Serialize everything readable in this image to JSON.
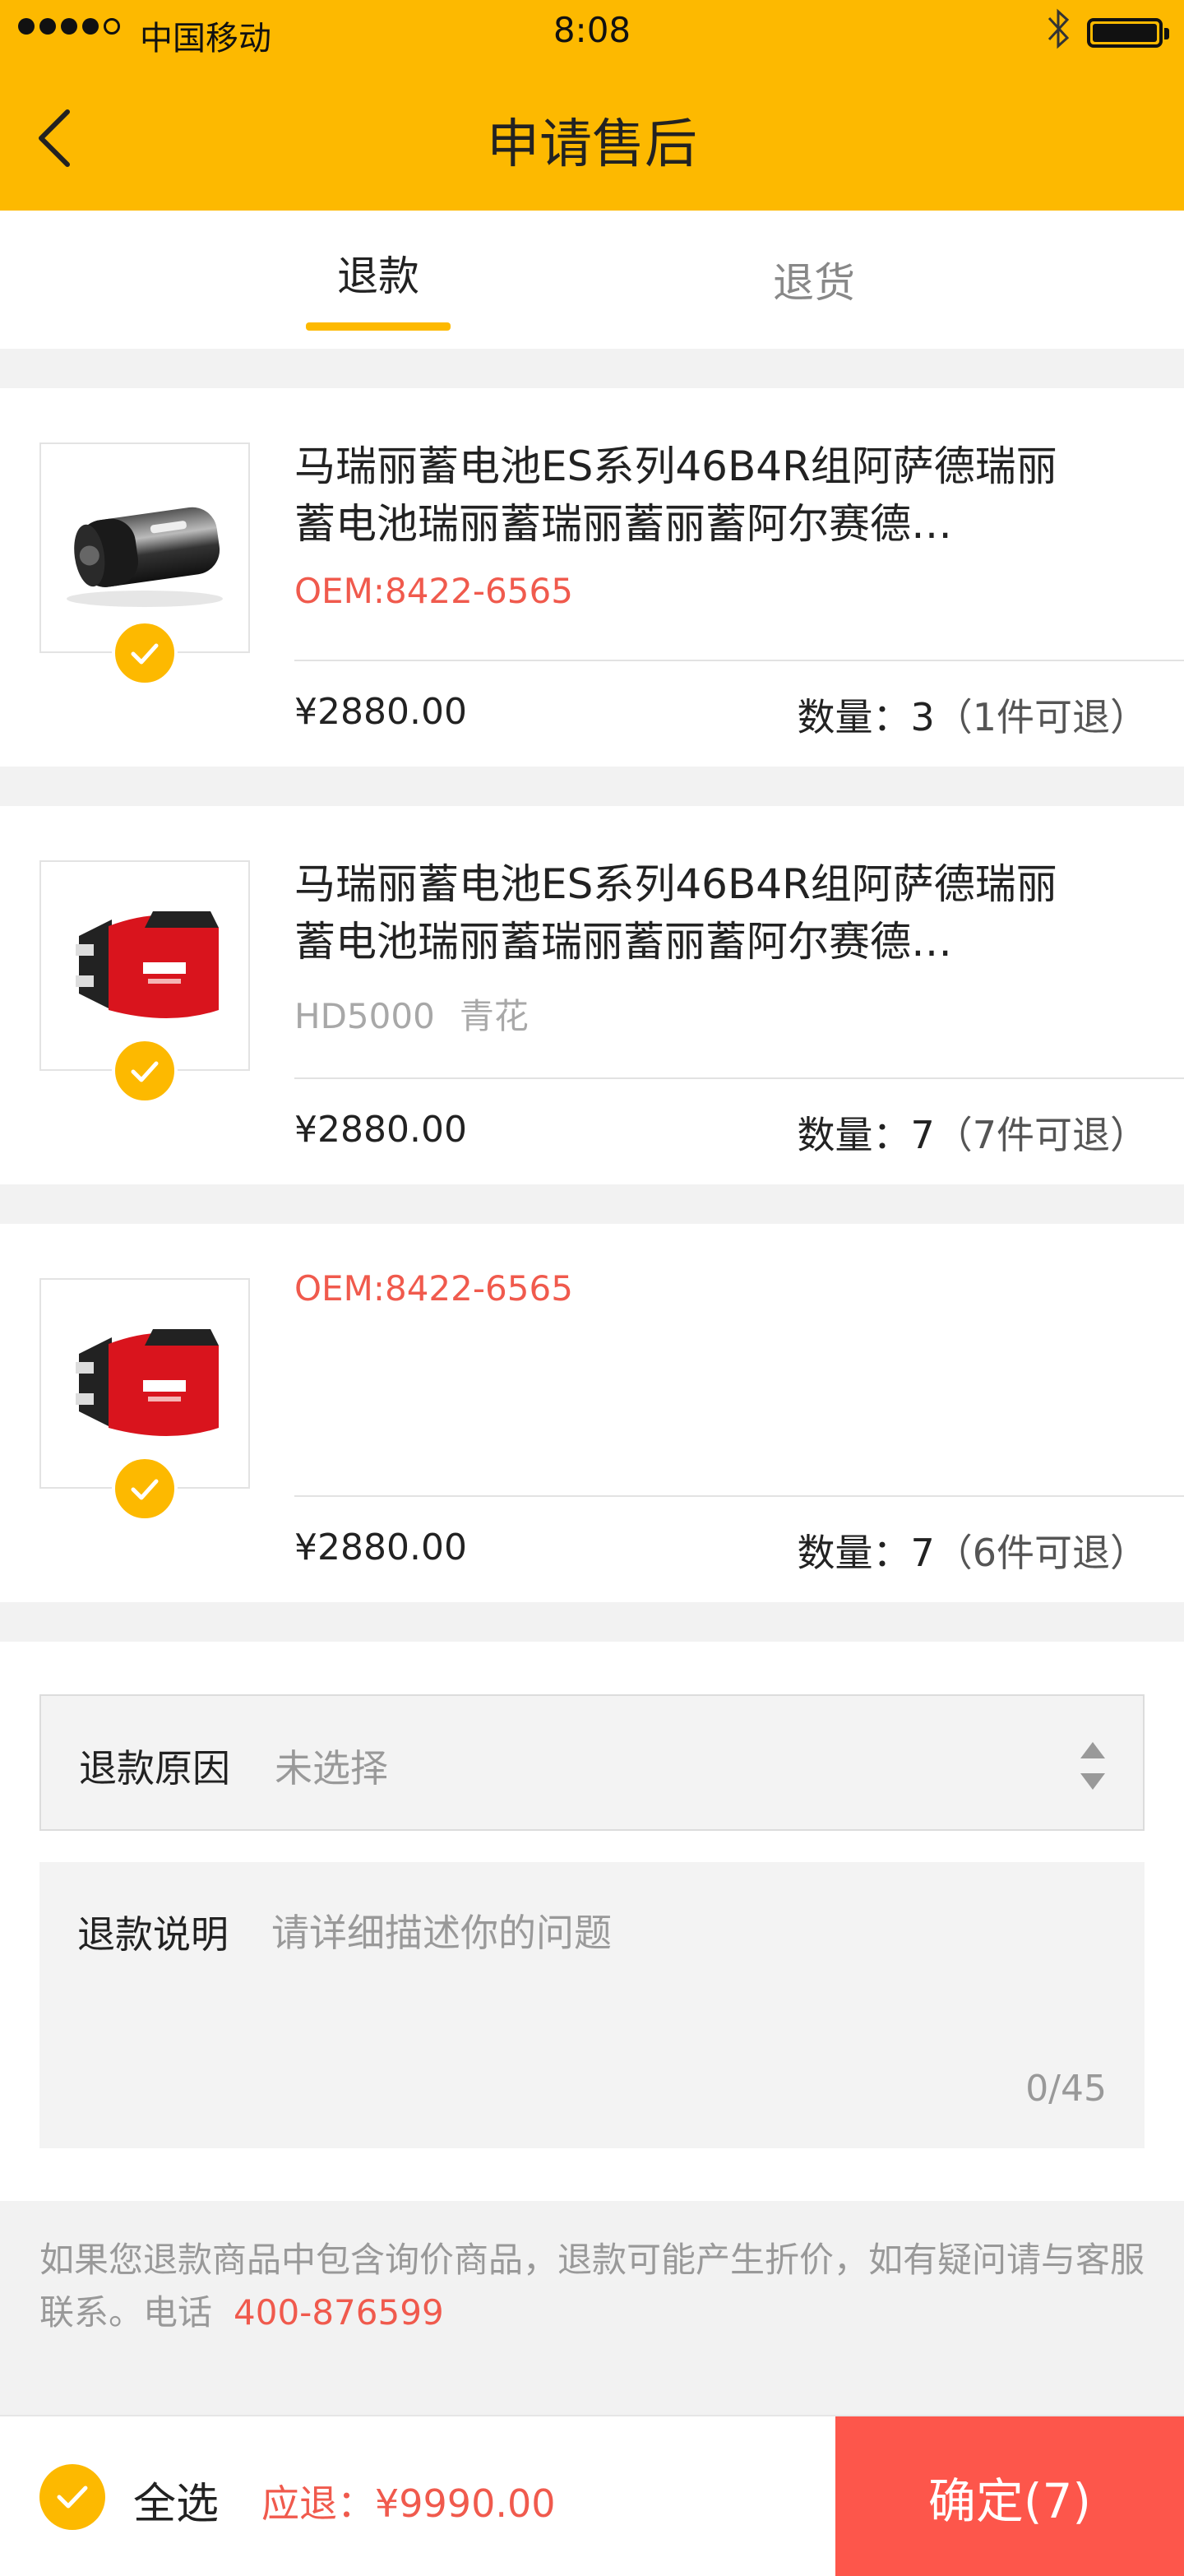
{
  "status_bar": {
    "carrier": "中国移动",
    "time": "8:08"
  },
  "nav": {
    "title": "申请售后"
  },
  "tabs": [
    {
      "label": "退款",
      "active": true
    },
    {
      "label": "退货",
      "active": false
    }
  ],
  "products": [
    {
      "title_line1": "马瑞丽蓄电池ES系列46B4R组阿萨德瑞丽",
      "title_line2": "蓄电池瑞丽蓄瑞丽蓄丽蓄阿尔赛德…",
      "spec": "OEM:8422-6565",
      "spec_color": "#f05a4d",
      "price": "¥2880.00",
      "qty_label": "数量：",
      "qty": "3",
      "available": "（1件可退）",
      "image": "black-cylinder-product",
      "selected": true
    },
    {
      "title_line1": "马瑞丽蓄电池ES系列46B4R组阿萨德瑞丽",
      "title_line2": "蓄电池瑞丽蓄瑞丽蓄丽蓄阿尔赛德…",
      "spec": "HD5000",
      "spec2": "青花",
      "spec_color": "#a8a8a8",
      "price": "¥2880.00",
      "qty_label": "数量：",
      "qty": "7",
      "available": "（7件可退）",
      "image": "red-battery-charger-product",
      "selected": true
    },
    {
      "title_line1": "",
      "title_line2": "",
      "spec": "OEM:8422-6565",
      "spec_color": "#f05a4d",
      "price": "¥2880.00",
      "qty_label": "数量：",
      "qty": "7",
      "available": "（6件可退）",
      "image": "red-battery-charger-product",
      "selected": true
    }
  ],
  "form": {
    "reason_label": "退款原因",
    "reason_value": "未选择",
    "desc_label": "退款说明",
    "desc_placeholder": "请详细描述你的问题",
    "desc_counter": "0/45"
  },
  "notice": {
    "text": "如果您退款商品中包含询价商品，退款可能产生折价，如有疑问请与客服联系。电话",
    "phone": "400-876599"
  },
  "bottom_bar": {
    "select_all": "全选",
    "total": "应退：¥9990.00",
    "confirm": "确定(7)"
  },
  "colors": {
    "brand": "#fdb900",
    "accent_red": "#f05a4d",
    "confirm_bg": "#fd564b"
  }
}
